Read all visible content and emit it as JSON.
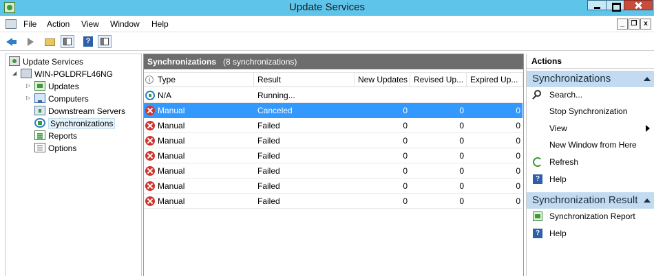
{
  "window": {
    "title": "Update Services"
  },
  "menu": {
    "items": [
      "File",
      "Action",
      "View",
      "Window",
      "Help"
    ]
  },
  "mdi_buttons": {
    "minimize": "_",
    "restore": "❐",
    "close": "x"
  },
  "tree": {
    "root": "Update Services",
    "server": "WIN-PGLDRFL46NG",
    "children": [
      "Updates",
      "Computers",
      "Downstream Servers",
      "Synchronizations",
      "Reports",
      "Options"
    ]
  },
  "center": {
    "title": "Synchronizations",
    "count": "(8 synchronizations)",
    "columns": [
      "Type",
      "Result",
      "New Updates",
      "Revised Up...",
      "Expired Up..."
    ],
    "rows": [
      {
        "status_icon": "running",
        "type": "N/A",
        "result": "Running...",
        "new_updates": "",
        "revised": "",
        "expired": ""
      },
      {
        "status_icon": "error",
        "type": "Manual",
        "result": "Canceled",
        "new_updates": "0",
        "revised": "0",
        "expired": "0"
      },
      {
        "status_icon": "error",
        "type": "Manual",
        "result": "Failed",
        "new_updates": "0",
        "revised": "0",
        "expired": "0"
      },
      {
        "status_icon": "error",
        "type": "Manual",
        "result": "Failed",
        "new_updates": "0",
        "revised": "0",
        "expired": "0"
      },
      {
        "status_icon": "error",
        "type": "Manual",
        "result": "Failed",
        "new_updates": "0",
        "revised": "0",
        "expired": "0"
      },
      {
        "status_icon": "error",
        "type": "Manual",
        "result": "Failed",
        "new_updates": "0",
        "revised": "0",
        "expired": "0"
      },
      {
        "status_icon": "error",
        "type": "Manual",
        "result": "Failed",
        "new_updates": "0",
        "revised": "0",
        "expired": "0"
      },
      {
        "status_icon": "error",
        "type": "Manual",
        "result": "Failed",
        "new_updates": "0",
        "revised": "0",
        "expired": "0"
      }
    ],
    "selected_row": 1
  },
  "actions": {
    "title": "Actions",
    "section1": {
      "title": "Synchronizations",
      "items": [
        "Search...",
        "Stop Synchronization",
        "View",
        "New Window from Here",
        "Refresh",
        "Help"
      ]
    },
    "section2": {
      "title": "Synchronization Result",
      "items": [
        "Synchronization Report",
        "Help"
      ]
    }
  },
  "colors": {
    "titlebar": "#5fc4ea",
    "selection": "#3399ff",
    "pane_header": "#6d6d6d",
    "action_section": "#c2dbf0",
    "error": "#d0342c"
  }
}
